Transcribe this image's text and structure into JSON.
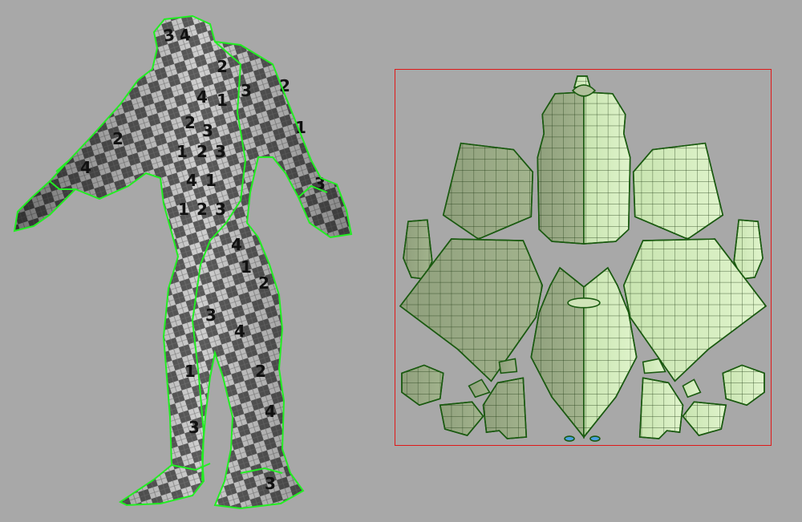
{
  "scene": {
    "background": "#a8a8a8",
    "seam_color": "#22ee22",
    "uv_boundary_color": "#e01818",
    "checker_numbers": [
      "1",
      "2",
      "3",
      "4"
    ],
    "model_icon": "character-mesh-icon",
    "uv_icon": "uv-layout-icon"
  },
  "colors": {
    "mesh_dark": "#3c3c3c",
    "mesh_light": "#d8d8d8",
    "island_dark": "#8f9f7c",
    "island_light": "#d8f0c0",
    "wire": "#1f3a14"
  }
}
